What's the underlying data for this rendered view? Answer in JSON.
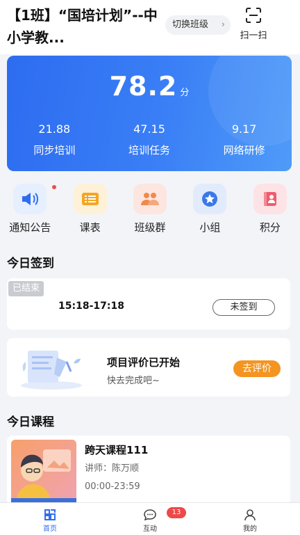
{
  "header": {
    "title": "【1班】“国培计划”--中小学教...",
    "switch_label": "切换班级",
    "scan_label": "扫一扫"
  },
  "score": {
    "value": "78.2",
    "unit": "分",
    "stats": [
      {
        "value": "21.88",
        "label": "同步培训"
      },
      {
        "value": "47.15",
        "label": "培训任务"
      },
      {
        "value": "9.17",
        "label": "网络研修"
      }
    ]
  },
  "menu": [
    {
      "label": "通知公告",
      "icon": "speaker-icon"
    },
    {
      "label": "课表",
      "icon": "schedule-icon"
    },
    {
      "label": "班级群",
      "icon": "group-chat-icon"
    },
    {
      "label": "小组",
      "icon": "star-icon"
    },
    {
      "label": "积分",
      "icon": "points-icon"
    }
  ],
  "signin": {
    "section_title": "今日签到",
    "status_tag": "已结束",
    "time_range": "15:18-17:18",
    "button_label": "未签到"
  },
  "evaluation": {
    "title": "项目评价已开始",
    "subtitle": "快去完成吧~",
    "button_label": "去评价"
  },
  "courses": {
    "section_title": "今日课程",
    "items": [
      {
        "name": "跨天课程111",
        "teacher": "讲师：陈万顺",
        "time": "00:00-23:59"
      }
    ]
  },
  "bottom_nav": [
    {
      "label": "首页",
      "icon": "home-icon",
      "active": true
    },
    {
      "label": "互动",
      "icon": "chat-icon",
      "badge": "13"
    },
    {
      "label": "我的",
      "icon": "profile-icon"
    }
  ],
  "colors": {
    "accent": "#2f6df0",
    "orange": "#f49521",
    "badge": "#f04848"
  }
}
